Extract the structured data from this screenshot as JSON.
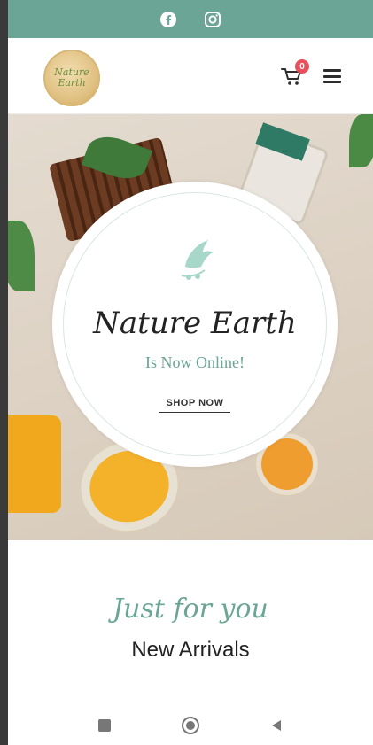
{
  "topbar": {
    "icons": [
      "facebook-icon",
      "instagram-icon"
    ],
    "bg_color": "#6aa595"
  },
  "header": {
    "logo": {
      "line1": "Nature",
      "line2": "Earth"
    },
    "cart_count": "0"
  },
  "hero": {
    "title": "Nature Earth",
    "subtitle": "Is Now Online!",
    "cta_label": "SHOP NOW"
  },
  "section": {
    "script_heading": "Just for you",
    "heading": "New Arrivals"
  },
  "system_nav": {
    "icons": [
      "recents-square-icon",
      "home-circle-icon",
      "back-triangle-icon"
    ]
  },
  "colors": {
    "accent": "#6aa595",
    "badge": "#e8505b"
  }
}
